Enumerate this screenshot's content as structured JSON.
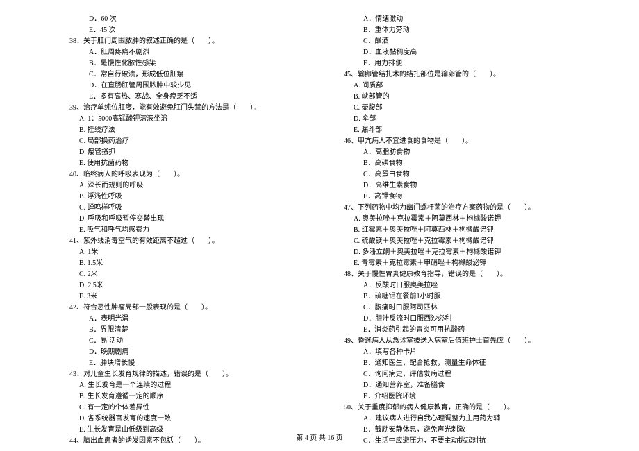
{
  "left_column": [
    {
      "type": "option",
      "text": "D．60 次"
    },
    {
      "type": "option",
      "text": "E．45 次"
    },
    {
      "type": "question",
      "text": "38、关于肛门周围脓肿的叙述正确的是（　　）。"
    },
    {
      "type": "option",
      "text": "A．肛周疼痛不剧烈"
    },
    {
      "type": "option",
      "text": "B．是慢性化脓性感染"
    },
    {
      "type": "option",
      "text": "C．常自行破溃，形成低位肛瘘"
    },
    {
      "type": "option",
      "text": "D．在直肠肛管周围脓肿中较少见"
    },
    {
      "type": "option",
      "text": "E．多有高热、寒战、全身疲乏不适"
    },
    {
      "type": "question",
      "text": "39、治疗单纯位肛瘘，能有效避免肛门失禁的方法是（　　）。"
    },
    {
      "type": "sub-option",
      "text": "A. 1：5000高锰酸钾溶液坐浴"
    },
    {
      "type": "sub-option",
      "text": "B. 挂线疗法"
    },
    {
      "type": "sub-option",
      "text": "C. 局部换药治疗"
    },
    {
      "type": "sub-option",
      "text": "D. 瘘管搔抓"
    },
    {
      "type": "sub-option",
      "text": "E. 使用抗菌药物"
    },
    {
      "type": "question",
      "text": "40、临终病人的呼吸表现为（　　）。"
    },
    {
      "type": "sub-option",
      "text": "A. 深长而规则的呼吸"
    },
    {
      "type": "sub-option",
      "text": "B. 浮浅性呼吸"
    },
    {
      "type": "sub-option",
      "text": "C. 蝉鸣样呼吸"
    },
    {
      "type": "sub-option",
      "text": "D. 呼吸和呼吸暂停交替出现"
    },
    {
      "type": "sub-option",
      "text": "E. 吸气和呼气均感费力"
    },
    {
      "type": "question",
      "text": "41、紫外线消毒空气的有效距离不超过（　　）。"
    },
    {
      "type": "sub-option",
      "text": "A. 1米"
    },
    {
      "type": "sub-option",
      "text": "B. 1.5米"
    },
    {
      "type": "sub-option",
      "text": "C. 2米"
    },
    {
      "type": "sub-option",
      "text": "D. 2.5米"
    },
    {
      "type": "sub-option",
      "text": "E. 3米"
    },
    {
      "type": "question",
      "text": "42、符合恶性肿瘤局部一般表现的是（　　）。"
    },
    {
      "type": "option",
      "text": "A．表明光滑"
    },
    {
      "type": "option",
      "text": "B．界限清楚"
    },
    {
      "type": "option",
      "text": "C．易 活动"
    },
    {
      "type": "option",
      "text": "D．晚期剧痛"
    },
    {
      "type": "option",
      "text": "E．肿块增长慢"
    },
    {
      "type": "question",
      "text": "43、对儿童生长发育规律的描述，错误的是（　　）。"
    },
    {
      "type": "sub-option",
      "text": "A. 生长发育是一个连续的过程"
    },
    {
      "type": "sub-option",
      "text": "B. 生长发育遵循一定的顺序"
    },
    {
      "type": "sub-option",
      "text": "C. 有一定的个体差异性"
    },
    {
      "type": "sub-option",
      "text": "D. 各系统器官发育的速度一致"
    },
    {
      "type": "sub-option",
      "text": "E. 生长发育是由低级到高级"
    },
    {
      "type": "question",
      "text": "44、脑出血患者的诱发因素不包括（　　）。"
    }
  ],
  "right_column": [
    {
      "type": "option",
      "text": "A．情绪激动"
    },
    {
      "type": "option",
      "text": "B．重体力劳动"
    },
    {
      "type": "option",
      "text": "C．酗酒"
    },
    {
      "type": "option",
      "text": "D．血液黏稠度高"
    },
    {
      "type": "option",
      "text": "E．用力排便"
    },
    {
      "type": "question",
      "text": "45、输卵管结扎术的结扎部位是输卵管的（　　）。"
    },
    {
      "type": "sub-option",
      "text": "A. 间质部"
    },
    {
      "type": "sub-option",
      "text": "B. 峡部管的"
    },
    {
      "type": "sub-option",
      "text": "C. 壶腹部"
    },
    {
      "type": "sub-option",
      "text": "D. 伞部"
    },
    {
      "type": "sub-option",
      "text": "E. 漏斗部"
    },
    {
      "type": "question",
      "text": "46、甲亢病人不宜进食的食物是（　　）。"
    },
    {
      "type": "option",
      "text": "A．高脂肪食物"
    },
    {
      "type": "option",
      "text": "B．高碘食物"
    },
    {
      "type": "option",
      "text": "C．高蛋白食物"
    },
    {
      "type": "option",
      "text": "D．高维生素食物"
    },
    {
      "type": "option",
      "text": "E．高钾食物"
    },
    {
      "type": "question",
      "text": "47、下列药物中均为幽门螺杆菌的治疗方案药物的是（　　）。"
    },
    {
      "type": "sub-option",
      "text": "A. 奥美拉唑＋克拉霉素＋阿莫西林＋枸橼酸诺钾"
    },
    {
      "type": "sub-option",
      "text": "B. 红霉素＋奥美拉唑＋阿莫西林＋枸橼酸诺钾"
    },
    {
      "type": "sub-option",
      "text": "C. 硫酸镁＋奥美拉唑＋克拉霉素＋枸橼酸诺钾"
    },
    {
      "type": "sub-option",
      "text": "D. 多潘立酮＋奥美拉唑＋克拉霉素＋枸橼酸诺钾"
    },
    {
      "type": "sub-option",
      "text": "E. 青霉素＋克拉霉素＋甲硝唑＋枸橼酸泌钾"
    },
    {
      "type": "question",
      "text": "48、关于慢性胃炎健康教育指导，错误的是（　　）。"
    },
    {
      "type": "option",
      "text": "A．反酸时口服奥美拉唑"
    },
    {
      "type": "option",
      "text": "B．硫糖铝在餐前1小时服"
    },
    {
      "type": "option",
      "text": "C．腹痛时口服阿司匹林"
    },
    {
      "type": "option",
      "text": "D．胆汁反流时口服西沙必利"
    },
    {
      "type": "option",
      "text": "E．消炎药引起的胃炎可用抗酸药"
    },
    {
      "type": "question",
      "text": "49、昏迷病人从急诊室被送入病室后值班护士首先应（　　）。"
    },
    {
      "type": "option",
      "text": "A．填写各种卡片"
    },
    {
      "type": "option",
      "text": "B．通知医生，配合抢救，测量生命体征"
    },
    {
      "type": "option",
      "text": "C．询问病史，评估发病过程"
    },
    {
      "type": "option",
      "text": "D．通知营养室，准备膳食"
    },
    {
      "type": "option",
      "text": "E．介绍医院环境"
    },
    {
      "type": "question",
      "text": "50、关于重度抑郁的病人健康教育，正确的是（　　）。"
    },
    {
      "type": "option",
      "text": "A．建议病人进行自我心理调整为主用药为辅"
    },
    {
      "type": "option",
      "text": "B．鼓励安静休息，避免声光刺激"
    },
    {
      "type": "option",
      "text": "C．生活中应避压力，不要主动挑起对抗"
    }
  ],
  "footer": "第 4 页 共 16 页"
}
